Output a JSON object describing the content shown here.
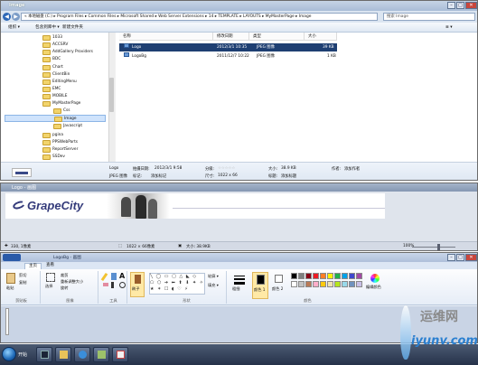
{
  "explorer": {
    "title": "Image",
    "address": "« 本地磁盘 (C:) ▸ Program Files ▸ Common Files ▸ Microsoft Shared ▸ Web Server Extensions ▸ 14 ▸ TEMPLATE ▸ LAYOUTS ▸ MyMasterPage ▸ Image",
    "search_placeholder": "搜索 Image",
    "toolbar": {
      "organize": "组织 ▾",
      "include": "包含到库中 ▾",
      "share": "共享 ▾",
      "burn": "刻录",
      "new_folder": "新建文件夹",
      "view": "≣ ▾"
    },
    "tree": [
      {
        "label": "1033",
        "selected": false
      },
      {
        "label": "ACCSRV",
        "selected": false
      },
      {
        "label": "AddGallery Providers",
        "selected": false
      },
      {
        "label": "BDC",
        "selected": false
      },
      {
        "label": "Chart",
        "selected": false
      },
      {
        "label": "ClientBin",
        "selected": false
      },
      {
        "label": "EditingMenu",
        "selected": false
      },
      {
        "label": "EMC",
        "selected": false
      },
      {
        "label": "MOBILE",
        "selected": false
      },
      {
        "label": "MyMasterPage",
        "selected": false
      },
      {
        "label": "Css",
        "selected": false
      },
      {
        "label": "Image",
        "selected": true
      },
      {
        "label": "Javascript",
        "selected": false
      },
      {
        "label": "pgina",
        "selected": false
      },
      {
        "label": "PPSWebParts",
        "selected": false
      },
      {
        "label": "ReportServer",
        "selected": false
      },
      {
        "label": "SSDev",
        "selected": false
      }
    ],
    "columns": {
      "name": "名称",
      "date": "修改日期",
      "type": "类型",
      "size": "大小"
    },
    "files": [
      {
        "name": "Logo",
        "date": "2012/3/1 10:35",
        "type": "JPEG 图像",
        "size": "39 KB",
        "selected": true
      },
      {
        "name": "LogoBg",
        "date": "2011/12/7 10:22",
        "type": "JPEG 图像",
        "size": "1 KB",
        "selected": false
      }
    ],
    "details": {
      "name": "Logo",
      "kind": "JPEG 图像",
      "date_taken_label": "拍摄日期:",
      "date_taken": "2012/3/1 9:58",
      "tags_label": "标记:",
      "tags": "添加标记",
      "rating_label": "分级:",
      "rating": "☆☆☆☆☆",
      "dims_label": "尺寸:",
      "dims": "1022 x 66",
      "size_label": "大小:",
      "size": "38.9 KB",
      "title_label": "标题:",
      "title": "添加标题",
      "author_label": "作者:",
      "author": "添加作者"
    }
  },
  "viewer": {
    "title": "Logo - 画图",
    "banner_text": "GrapeCity",
    "status_pos": "330, 1像素",
    "status_dims": "1022 × 66像素",
    "status_size": "大小: 38.9KB",
    "zoom": "100%"
  },
  "paint": {
    "title": "LogoBg - 画图",
    "tabs": [
      "主页",
      "查看"
    ],
    "groups": {
      "clipboard": "剪贴板",
      "image": "图像",
      "tools": "工具",
      "shapes": "形状",
      "colors": "颜色"
    },
    "buttons": {
      "paste": "粘贴",
      "cut": "剪切",
      "copy": "复制",
      "select": "选择",
      "crop": "裁剪",
      "resize": "重新调整大小",
      "rotate": "旋转",
      "brushes": "刷子",
      "outline": "轮廓 ▾",
      "fill": "填充 ▾",
      "size": "粗细",
      "color1": "颜色 1",
      "color2": "颜色 2",
      "edit_colors": "编辑颜色"
    },
    "palette": [
      "#000000",
      "#7f7f7f",
      "#880015",
      "#ed1c24",
      "#ff7f27",
      "#fff200",
      "#22b14c",
      "#00a2e8",
      "#3f48cc",
      "#a349a4",
      "#ffffff",
      "#c3c3c3",
      "#b97a57",
      "#ffaec9",
      "#ffc90e",
      "#efe4b0",
      "#b5e61d",
      "#99d9ea",
      "#7092be",
      "#c8bfe7"
    ]
  },
  "taskbar": {
    "start": "开始"
  },
  "watermark": {
    "cn": "运维网",
    "en": "iyunv.com"
  }
}
